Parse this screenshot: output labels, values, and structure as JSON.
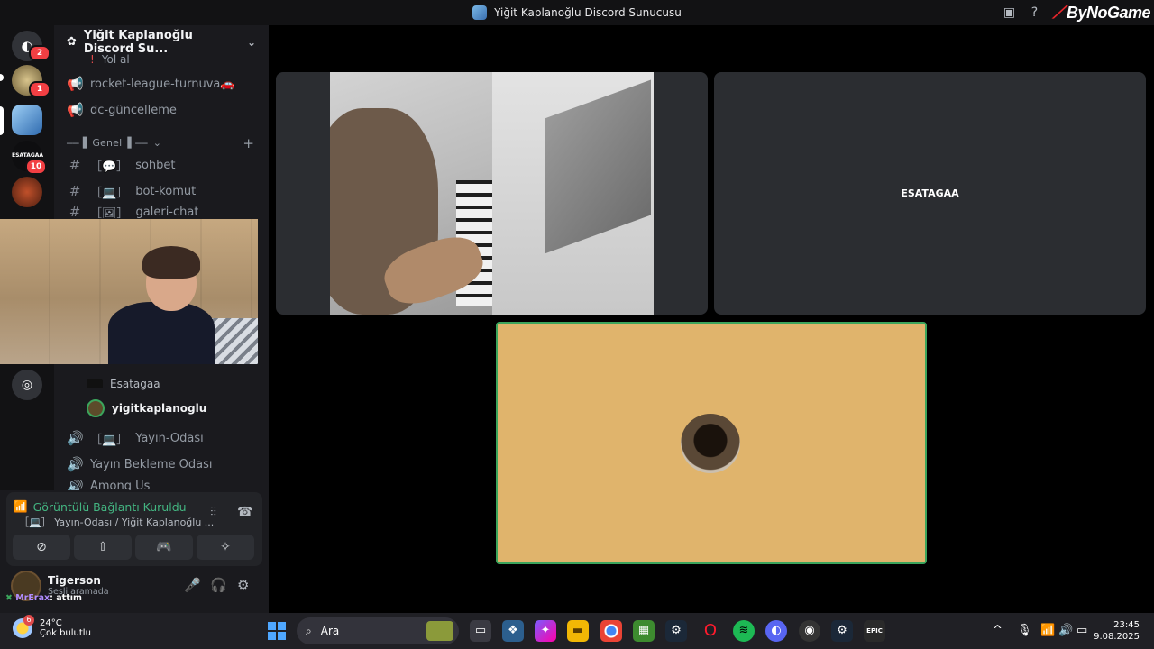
{
  "window": {
    "title": "Yiğit Kaplanoğlu Discord Sunucusu",
    "brand": "ByNoGame"
  },
  "server": {
    "name": "Yiğit Kaplanoğlu Discord Su..."
  },
  "guild_badges": {
    "home": "2",
    "g1": "1",
    "esatagaa_label": "ESATAGAA",
    "esatagaa_badge": "10"
  },
  "channels": {
    "partial_top": "Yol al",
    "rocket": "rocket-league-turnuva🚗",
    "dc": "dc-güncelleme",
    "category": "Genel",
    "sohbet": "sohbet",
    "bot": "bot-komut",
    "galeri": "galeri-chat",
    "yayin": "Yayın-Odası",
    "bekleme": "Yayın Bekleme Odası",
    "among": "Among Us"
  },
  "voice_members": {
    "m1": "Esatagaa",
    "m2": "yigitkaplanoglu"
  },
  "voice_status": {
    "title": "Görüntülü Bağlantı Kuruldu",
    "subtitle": "Yayın-Odası / Yiğit Kaplanoğlu ..."
  },
  "user": {
    "name": "Tigerson",
    "status": "Sesli aramada"
  },
  "chat_overlay": {
    "user": "MrErax",
    "message": ": attım"
  },
  "stage": {
    "tile2_name": "ESATAGAA"
  },
  "taskbar": {
    "weather_badge": "6",
    "temp": "24°C",
    "weather": "Çok bulutlu",
    "search": "Ara",
    "time": "23:45",
    "date": "9.08.2025"
  }
}
